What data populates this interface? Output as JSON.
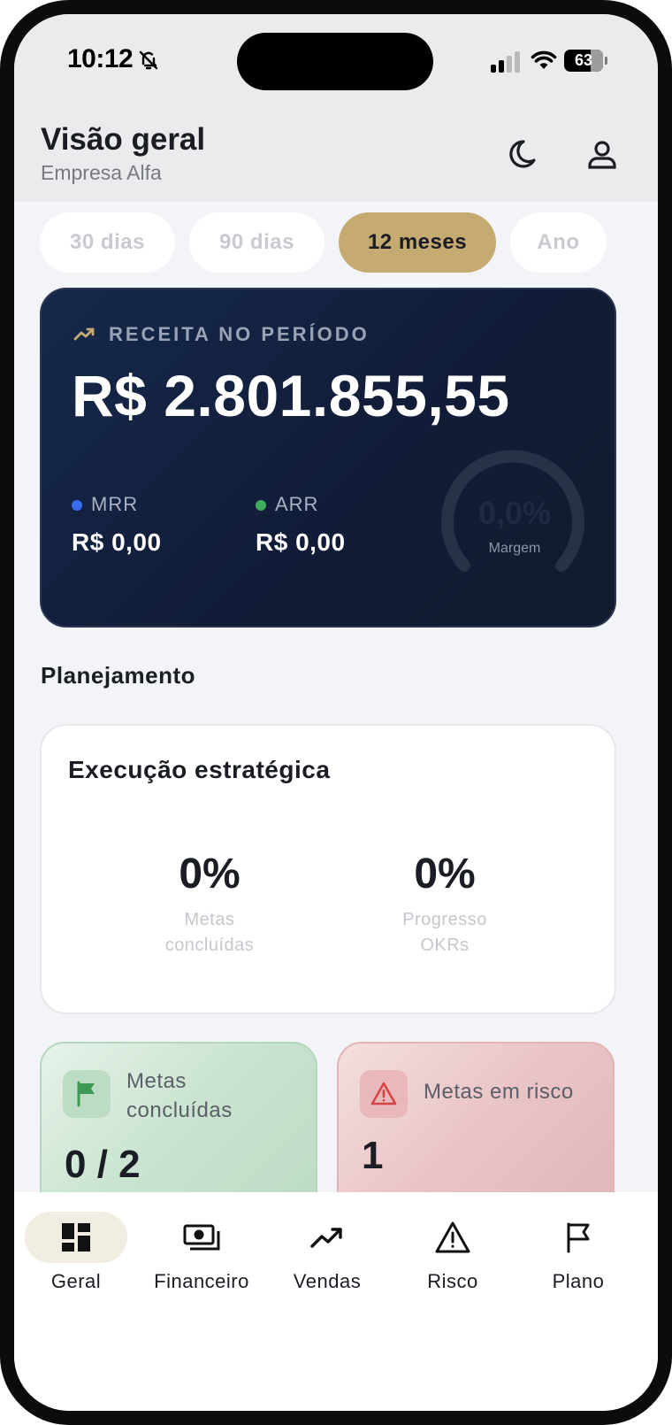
{
  "status_bar": {
    "time": "10:12",
    "battery": "63"
  },
  "header": {
    "title": "Visão geral",
    "subtitle": "Empresa Alfa"
  },
  "periods": [
    {
      "label": "30 dias",
      "active": false
    },
    {
      "label": "90 dias",
      "active": false
    },
    {
      "label": "12 meses",
      "active": true
    },
    {
      "label": "Ano",
      "active": false
    }
  ],
  "revenue": {
    "label": "RECEITA NO PERÍODO",
    "value": "R$ 2.801.855,55",
    "mrr": {
      "label": "MRR",
      "value": "R$ 0,00",
      "color": "#3b6cf0"
    },
    "arr": {
      "label": "ARR",
      "value": "R$ 0,00",
      "color": "#3fae5a"
    },
    "margin": {
      "value": "0,0%",
      "label": "Margem",
      "fraction": 0
    }
  },
  "planning": {
    "section_title": "Planejamento",
    "card_title": "Execução estratégica",
    "stats": [
      {
        "value": "0%",
        "label_line1": "Metas",
        "label_line2": "concluídas"
      },
      {
        "value": "0%",
        "label_line1": "Progresso",
        "label_line2": "OKRs"
      }
    ]
  },
  "goals_done": {
    "label_line1": "Metas",
    "label_line2": "concluídas",
    "value": "0 / 2",
    "icon": "flag-icon"
  },
  "goals_risk": {
    "label": "Metas em risco",
    "value": "1",
    "icon": "warning-icon"
  },
  "tabbar": [
    {
      "label": "Geral",
      "icon": "dashboard-icon",
      "active": true
    },
    {
      "label": "Financeiro",
      "icon": "cash-icon",
      "active": false
    },
    {
      "label": "Vendas",
      "icon": "trend-icon",
      "active": false
    },
    {
      "label": "Risco",
      "icon": "warning-icon",
      "active": false
    },
    {
      "label": "Plano",
      "icon": "flag-icon",
      "active": false
    }
  ],
  "colors": {
    "accent": "#c5aa72",
    "card_dark": "#131e38",
    "success": "#3fae5a",
    "danger": "#d64545"
  }
}
